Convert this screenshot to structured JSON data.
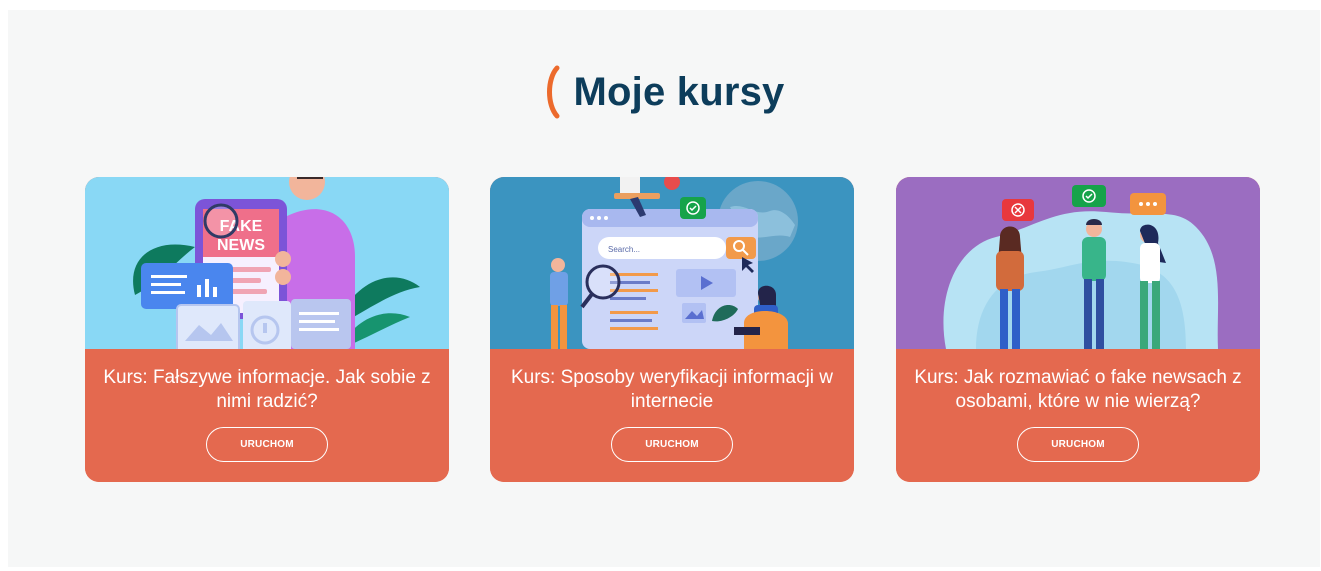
{
  "page": {
    "title": "Moje kursy",
    "accent_color": "#ec6a2c",
    "title_color": "#0d3d5b",
    "card_color": "#e4694f"
  },
  "courses": [
    {
      "title": "Kurs: Fałszywe informacje. Jak sobie z nimi radzić?",
      "button_label": "URUCHOM",
      "image": {
        "illustration": "fake-news-illustration",
        "bg_color": "#89d8f5",
        "tablet_text_line1": "FAKE",
        "tablet_text_line2": "NEWS"
      }
    },
    {
      "title": "Kurs: Sposoby weryfikacji informacji w internecie",
      "button_label": "URUCHOM",
      "image": {
        "illustration": "web-search-illustration",
        "bg_color": "#3b94c0",
        "search_placeholder": "Search..."
      }
    },
    {
      "title": "Kurs: Jak rozmawiać o fake newsach z osobami, które w nie wierzą?",
      "button_label": "URUCHOM",
      "image": {
        "illustration": "discussion-illustration",
        "bg_color": "#9b6dc1"
      }
    }
  ]
}
